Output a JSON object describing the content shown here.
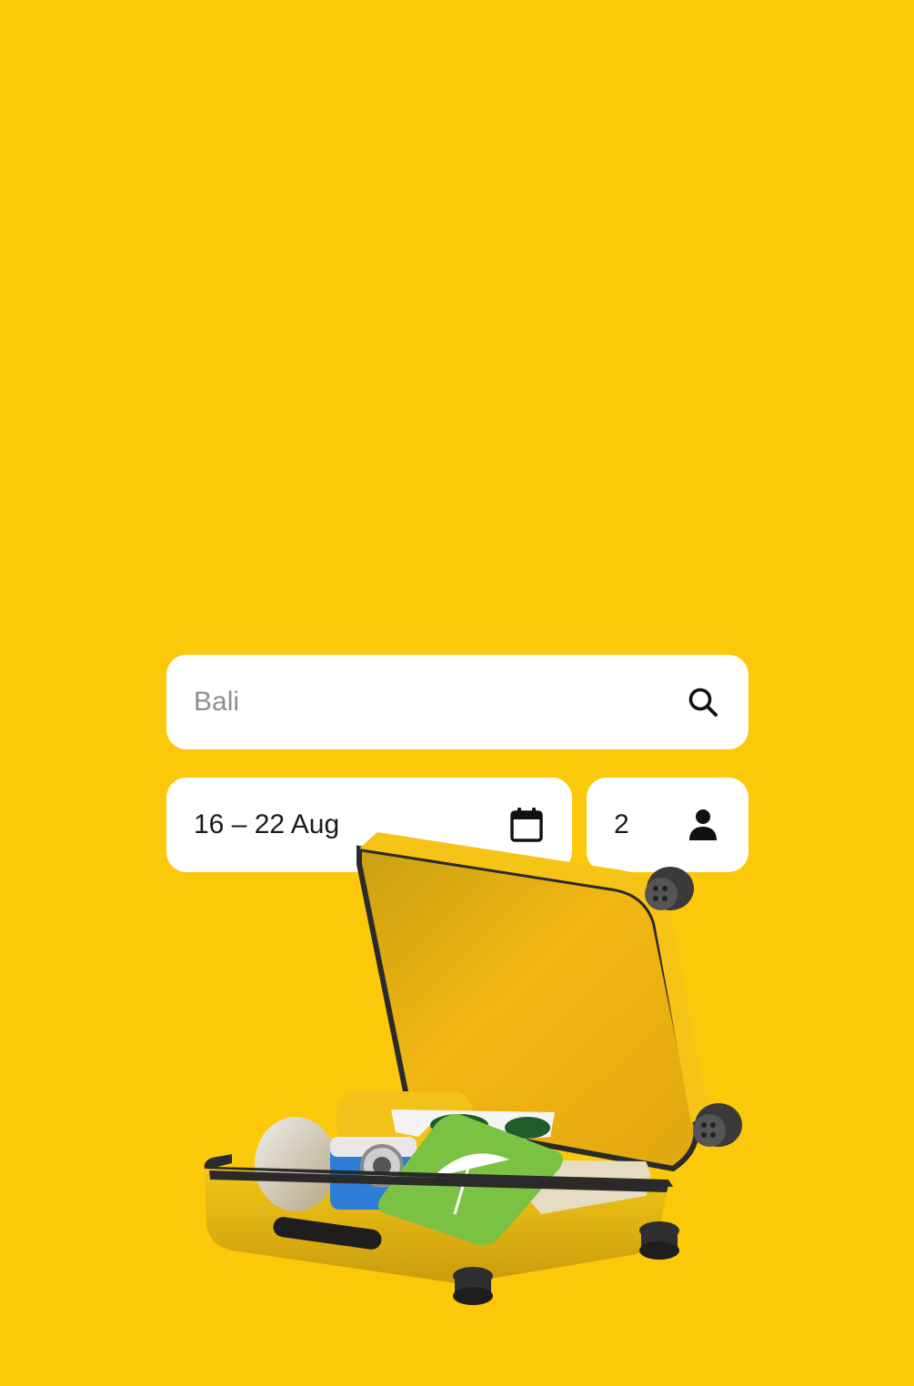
{
  "search": {
    "value": "",
    "placeholder": "Bali",
    "icon": "search-icon"
  },
  "dates": {
    "value": "16 – 22 Aug",
    "icon": "calendar-icon"
  },
  "guests": {
    "value": "2",
    "icon": "person-icon"
  },
  "colors": {
    "background": "#FCC80A",
    "field": "#FFFFFF",
    "text": "#1A1A1A",
    "placeholder": "#8A9096"
  },
  "illustration": "open-suitcase-illustration"
}
